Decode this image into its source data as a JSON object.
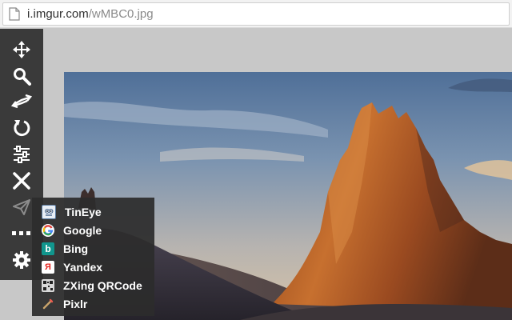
{
  "addressbar": {
    "host": "i.imgur.com",
    "path": "/wMBC0.jpg",
    "page_icon": "page-icon"
  },
  "toolbar": {
    "tools": [
      {
        "name": "move-icon"
      },
      {
        "name": "zoom-icon"
      },
      {
        "name": "flip-icon"
      },
      {
        "name": "rotate-icon"
      },
      {
        "name": "adjust-icon"
      },
      {
        "name": "close-icon"
      },
      {
        "name": "send-icon"
      },
      {
        "name": "more-icon"
      },
      {
        "name": "settings-icon"
      }
    ]
  },
  "menu": {
    "items": [
      {
        "label": "TinEye",
        "icon": "tineye-icon"
      },
      {
        "label": "Google",
        "icon": "google-icon"
      },
      {
        "label": "Bing",
        "icon": "bing-icon"
      },
      {
        "label": "Yandex",
        "icon": "yandex-icon"
      },
      {
        "label": "ZXing QRCode",
        "icon": "zxing-icon"
      },
      {
        "label": "Pixlr",
        "icon": "pixlr-icon"
      }
    ]
  },
  "colors": {
    "toolbar_bg": "#3a3a3a",
    "menu_bg": "#2c2c2c",
    "viewer_bg": "#c8c8c8"
  }
}
